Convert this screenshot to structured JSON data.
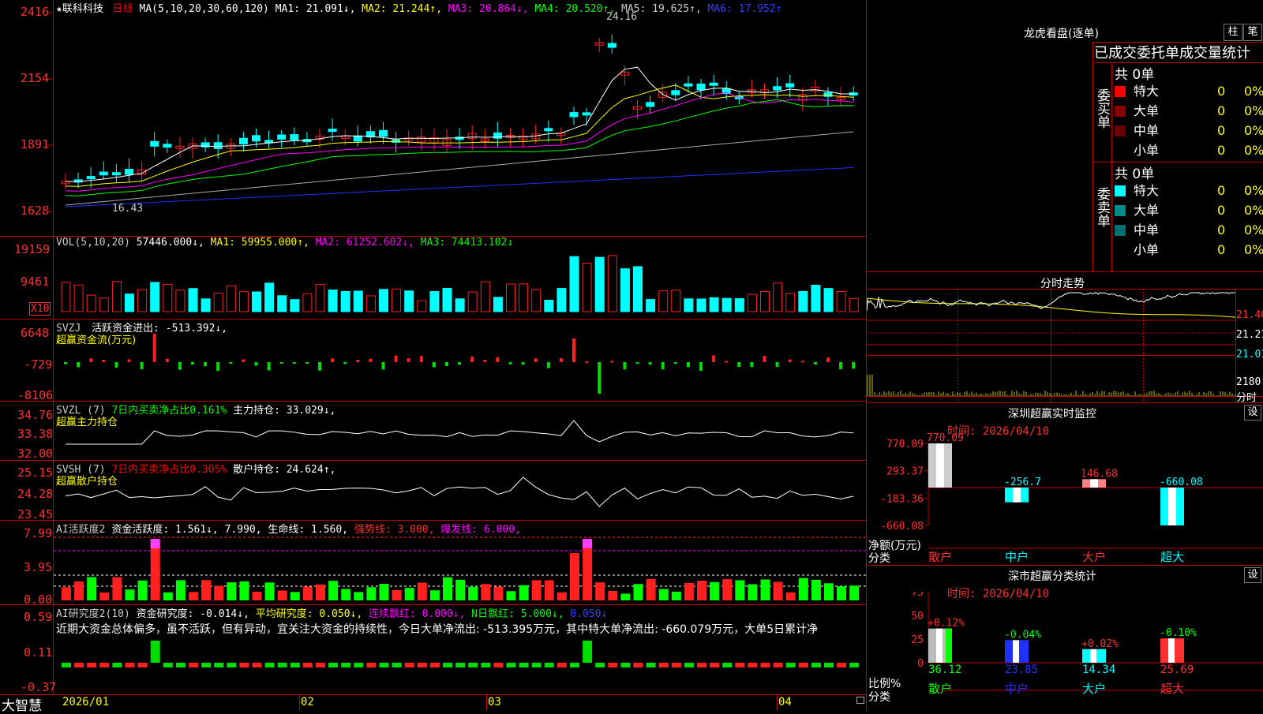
{
  "main_chart": {
    "header": {
      "star": "★",
      "stock_name": "联科科技",
      "period": "日线",
      "ma_params": "MA(5,10,20,30,60,120)",
      "ma1": "MA1: 21.091↓,",
      "ma2": "MA2: 21.244↑,",
      "ma3": "MA3: 20.864↓,",
      "ma4": "MA4: 20.520↑,",
      "ma5": "MA5: 19.625↑,",
      "ma6": "MA6: 17.952↑"
    },
    "yticks": [
      "2416",
      "2154",
      "1891",
      "1628"
    ],
    "high_label": "24.16",
    "low_label": "16.43"
  },
  "vol_panel": {
    "header": {
      "name": "VOL(5,10,20)",
      "vol": "57446.000↓,",
      "ma1": "MA1: 59955.000↑,",
      "ma2": "MA2: 61252.602↓,",
      "ma3": "MA3: 74413.102↓"
    },
    "yticks": [
      "19159",
      "9461"
    ],
    "unit": "X10"
  },
  "svzj_panel": {
    "header": {
      "name": "SVZJ",
      "desc": "活跃资金进出: -513.392↓,",
      "sub": "超赢资金流(万元)"
    },
    "yticks": [
      "6648",
      "-729",
      "-8106"
    ]
  },
  "svzl_panel": {
    "header": {
      "name": "SVZL (7)",
      "desc": "7日内买卖净占比0.161%",
      "hold": "主力持仓: 33.029↓,",
      "sub": "超赢主力持仓"
    },
    "yticks": [
      "34.76",
      "33.38",
      "32.00"
    ]
  },
  "svsh_panel": {
    "header": {
      "name": "SVSH (7)",
      "desc": "7日内买卖净占比0.305%",
      "hold": "散户持仓: 24.624↑,",
      "sub": "超赢散户持仓"
    },
    "yticks": [
      "25.15",
      "24.28",
      "23.45"
    ]
  },
  "ai_active": {
    "header": {
      "name": "AI活跃度2",
      "v1": "资金活跃度: 1.561↓,",
      "v2": "7.990,",
      "v3": "生命线: 1.560,",
      "v4": "强势线: 3.000,",
      "v5": "爆发线: 6.000,"
    },
    "yticks": [
      "7.99",
      "3.95",
      "0.00"
    ]
  },
  "ai_research": {
    "header": {
      "name": "AI研究度2(10)",
      "v1": "资金研究度: -0.014↓,",
      "v2": "平均研究度: 0.050↓,",
      "v3": "连续飘红: 0.000↓,",
      "v4": "N日飘红: 5.000↓,",
      "v5": "0.050↓"
    },
    "comment": "近期大资金总体偏多，虽不活跃，但有异动，宜关注大资金的持续性，今日大单净流出: -513.395万元，其中特大单净流出: -660.079万元，大单5日累计净",
    "yticks": [
      "0.59",
      "0.11",
      "-0.37"
    ]
  },
  "xaxis": {
    "brand": "大智慧",
    "labels": [
      "2026/01",
      "02",
      "03",
      "04"
    ]
  },
  "dragon_board": {
    "title": "龙虎看盘(逐单)",
    "btn_zhu": "柱",
    "btn_bi": "笔",
    "tabs": "已成交委托单成交量统计",
    "buy_label": "委买单",
    "sell_label": "委卖单",
    "buy_total": "共 0单",
    "sell_total": "共 0单",
    "rows": [
      {
        "name": "特大",
        "num": "0",
        "pct": "0%"
      },
      {
        "name": "大单",
        "num": "0",
        "pct": "0%"
      },
      {
        "name": "中单",
        "num": "0",
        "pct": "0%"
      },
      {
        "name": "小单",
        "num": "0",
        "pct": "0%"
      }
    ],
    "colors_buy": [
      "#ff0000",
      "#8b0000",
      "#6a0000",
      "#000000"
    ],
    "colors_sell": [
      "#00ffff",
      "#008b8b",
      "#007070",
      "#000000"
    ]
  },
  "intraday": {
    "title": "分时走势",
    "prices": [
      "21.40",
      "21.21",
      "21.01"
    ],
    "vol_label": "2180",
    "vol_unit": "分时"
  },
  "sz_monitor": {
    "title": "深圳超赢实时监控",
    "btn": "设",
    "time": "时间: 2026/04/10",
    "yticks": [
      "770.09",
      "293.37",
      "-183.36",
      "-660.08"
    ],
    "ylabel1": "净额(万元)",
    "ylabel2": "分类",
    "categories": [
      "散户",
      "中户",
      "大户",
      "超大"
    ],
    "values": [
      770.09,
      -256.7,
      146.68,
      -660.08
    ],
    "value_labels": [
      "770.09",
      "-256.7",
      "146.68",
      "-660.08"
    ]
  },
  "sz_class": {
    "title": "深市超赢分类统计",
    "btn": "设",
    "time": "时间: 2026/04/10",
    "yticks": [
      "75",
      "50",
      "25",
      "0"
    ],
    "ylabel1": "比例%",
    "ylabel2": "分类",
    "categories": [
      "散户",
      "中户",
      "大户",
      "超大"
    ],
    "values": [
      36.12,
      23.85,
      14.34,
      25.69
    ],
    "changes": [
      "+0.12%",
      "-0.04%",
      "+0.02%",
      "-0.10%"
    ]
  }
}
